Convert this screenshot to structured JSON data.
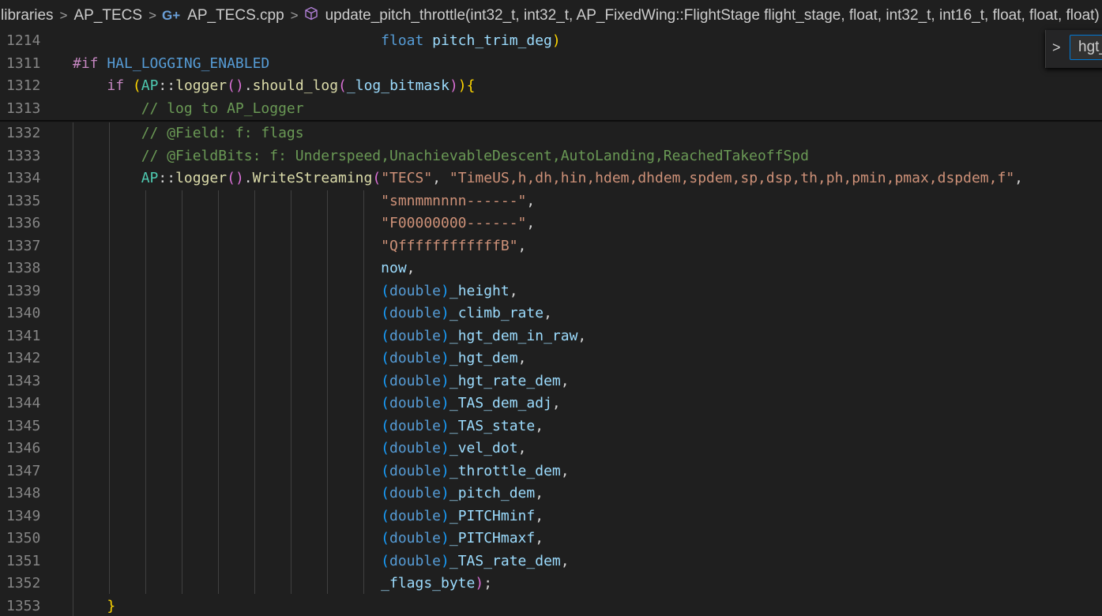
{
  "breadcrumb": {
    "items": [
      "libraries",
      "AP_TECS",
      "AP_TECS.cpp",
      "update_pitch_throttle(int32_t, int32_t, AP_FixedWing::FlightStage flight_stage, float, int32_t, int16_t, float, float, float)"
    ],
    "separator": ">",
    "file_icon": "c++-icon",
    "symbol_icon": "method-cube-icon"
  },
  "find_widget": {
    "toggle_icon": "chevron-right-icon",
    "value": "hgt_"
  },
  "sticky_lines": [
    {
      "num": "1214",
      "indent": 0,
      "tokens": [
        [
          "plain",
          "                                    "
        ],
        [
          "type",
          "float"
        ],
        [
          "plain",
          " "
        ],
        [
          "var",
          "pitch_trim_deg"
        ],
        [
          "p1",
          ")"
        ]
      ]
    },
    {
      "num": "1311",
      "indent": 0,
      "tokens": [
        [
          "pp",
          "#if"
        ],
        [
          "plain",
          " "
        ],
        [
          "macro",
          "HAL_LOGGING_ENABLED"
        ]
      ]
    },
    {
      "num": "1312",
      "indent": 0,
      "tokens": [
        [
          "plain",
          "    "
        ],
        [
          "kw",
          "if"
        ],
        [
          "plain",
          " "
        ],
        [
          "p1",
          "("
        ],
        [
          "ns",
          "AP"
        ],
        [
          "plain",
          "::"
        ],
        [
          "func",
          "logger"
        ],
        [
          "p2",
          "()"
        ],
        [
          "plain",
          "."
        ],
        [
          "func",
          "should_log"
        ],
        [
          "p2",
          "("
        ],
        [
          "var",
          "_log_bitmask"
        ],
        [
          "p2",
          ")"
        ],
        [
          "p1",
          ")"
        ],
        [
          "p1",
          "{"
        ]
      ]
    },
    {
      "num": "1313",
      "indent": 0,
      "tokens": [
        [
          "plain",
          "        "
        ],
        [
          "com",
          "// log to AP_Logger"
        ]
      ]
    }
  ],
  "lines": [
    {
      "num": "1332",
      "tokens": [
        [
          "plain",
          "        "
        ],
        [
          "com",
          "// @Field: f: flags"
        ]
      ]
    },
    {
      "num": "1333",
      "tokens": [
        [
          "plain",
          "        "
        ],
        [
          "com",
          "// @FieldBits: f: Underspeed,UnachievableDescent,AutoLanding,ReachedTakeoffSpd"
        ]
      ]
    },
    {
      "num": "1334",
      "tokens": [
        [
          "plain",
          "        "
        ],
        [
          "ns",
          "AP"
        ],
        [
          "plain",
          "::"
        ],
        [
          "func",
          "logger"
        ],
        [
          "p2",
          "()"
        ],
        [
          "plain",
          "."
        ],
        [
          "func",
          "WriteStreaming"
        ],
        [
          "p2",
          "("
        ],
        [
          "str",
          "\"TECS\""
        ],
        [
          "plain",
          ", "
        ],
        [
          "str",
          "\"TimeUS,h,dh,hin,hdem,dhdem,spdem,sp,dsp,th,ph,pmin,pmax,dspdem,f\""
        ],
        [
          "plain",
          ","
        ]
      ]
    },
    {
      "num": "1335",
      "tokens": [
        [
          "plain",
          "                                    "
        ],
        [
          "str",
          "\"smnmmnnnn------\""
        ],
        [
          "plain",
          ","
        ]
      ]
    },
    {
      "num": "1336",
      "tokens": [
        [
          "plain",
          "                                    "
        ],
        [
          "str",
          "\"F00000000------\""
        ],
        [
          "plain",
          ","
        ]
      ]
    },
    {
      "num": "1337",
      "tokens": [
        [
          "plain",
          "                                    "
        ],
        [
          "str",
          "\"QffffffffffffB\""
        ],
        [
          "plain",
          ","
        ]
      ]
    },
    {
      "num": "1338",
      "tokens": [
        [
          "plain",
          "                                    "
        ],
        [
          "var",
          "now"
        ],
        [
          "plain",
          ","
        ]
      ]
    },
    {
      "num": "1339",
      "tokens": [
        [
          "plain",
          "                                    "
        ],
        [
          "p3",
          "("
        ],
        [
          "type",
          "double"
        ],
        [
          "p3",
          ")"
        ],
        [
          "var",
          "_height"
        ],
        [
          "plain",
          ","
        ]
      ]
    },
    {
      "num": "1340",
      "tokens": [
        [
          "plain",
          "                                    "
        ],
        [
          "p3",
          "("
        ],
        [
          "type",
          "double"
        ],
        [
          "p3",
          ")"
        ],
        [
          "var",
          "_climb_rate"
        ],
        [
          "plain",
          ","
        ]
      ]
    },
    {
      "num": "1341",
      "tokens": [
        [
          "plain",
          "                                    "
        ],
        [
          "p3",
          "("
        ],
        [
          "type",
          "double"
        ],
        [
          "p3",
          ")"
        ],
        [
          "var",
          "_hgt_dem_in_raw"
        ],
        [
          "plain",
          ","
        ]
      ]
    },
    {
      "num": "1342",
      "tokens": [
        [
          "plain",
          "                                    "
        ],
        [
          "p3",
          "("
        ],
        [
          "type",
          "double"
        ],
        [
          "p3",
          ")"
        ],
        [
          "var",
          "_hgt_dem"
        ],
        [
          "plain",
          ","
        ]
      ]
    },
    {
      "num": "1343",
      "tokens": [
        [
          "plain",
          "                                    "
        ],
        [
          "p3",
          "("
        ],
        [
          "type",
          "double"
        ],
        [
          "p3",
          ")"
        ],
        [
          "var",
          "_hgt_rate_dem"
        ],
        [
          "plain",
          ","
        ]
      ]
    },
    {
      "num": "1344",
      "tokens": [
        [
          "plain",
          "                                    "
        ],
        [
          "p3",
          "("
        ],
        [
          "type",
          "double"
        ],
        [
          "p3",
          ")"
        ],
        [
          "var",
          "_TAS_dem_adj"
        ],
        [
          "plain",
          ","
        ]
      ]
    },
    {
      "num": "1345",
      "tokens": [
        [
          "plain",
          "                                    "
        ],
        [
          "p3",
          "("
        ],
        [
          "type",
          "double"
        ],
        [
          "p3",
          ")"
        ],
        [
          "var",
          "_TAS_state"
        ],
        [
          "plain",
          ","
        ]
      ]
    },
    {
      "num": "1346",
      "tokens": [
        [
          "plain",
          "                                    "
        ],
        [
          "p3",
          "("
        ],
        [
          "type",
          "double"
        ],
        [
          "p3",
          ")"
        ],
        [
          "var",
          "_vel_dot"
        ],
        [
          "plain",
          ","
        ]
      ]
    },
    {
      "num": "1347",
      "tokens": [
        [
          "plain",
          "                                    "
        ],
        [
          "p3",
          "("
        ],
        [
          "type",
          "double"
        ],
        [
          "p3",
          ")"
        ],
        [
          "var",
          "_throttle_dem"
        ],
        [
          "plain",
          ","
        ]
      ]
    },
    {
      "num": "1348",
      "tokens": [
        [
          "plain",
          "                                    "
        ],
        [
          "p3",
          "("
        ],
        [
          "type",
          "double"
        ],
        [
          "p3",
          ")"
        ],
        [
          "var",
          "_pitch_dem"
        ],
        [
          "plain",
          ","
        ]
      ]
    },
    {
      "num": "1349",
      "tokens": [
        [
          "plain",
          "                                    "
        ],
        [
          "p3",
          "("
        ],
        [
          "type",
          "double"
        ],
        [
          "p3",
          ")"
        ],
        [
          "var",
          "_PITCHminf"
        ],
        [
          "plain",
          ","
        ]
      ]
    },
    {
      "num": "1350",
      "tokens": [
        [
          "plain",
          "                                    "
        ],
        [
          "p3",
          "("
        ],
        [
          "type",
          "double"
        ],
        [
          "p3",
          ")"
        ],
        [
          "var",
          "_PITCHmaxf"
        ],
        [
          "plain",
          ","
        ]
      ]
    },
    {
      "num": "1351",
      "tokens": [
        [
          "plain",
          "                                    "
        ],
        [
          "p3",
          "("
        ],
        [
          "type",
          "double"
        ],
        [
          "p3",
          ")"
        ],
        [
          "var",
          "_TAS_rate_dem"
        ],
        [
          "plain",
          ","
        ]
      ]
    },
    {
      "num": "1352",
      "tokens": [
        [
          "plain",
          "                                    "
        ],
        [
          "var",
          "_flags_byte"
        ],
        [
          "p2",
          ")"
        ],
        [
          "plain",
          ";"
        ]
      ]
    },
    {
      "num": "1353",
      "tokens": [
        [
          "plain",
          "    "
        ],
        [
          "p1",
          "}"
        ]
      ]
    }
  ],
  "colors": {
    "background": "#1f1f1f",
    "line_number": "#858585",
    "keyword": "#c586c0",
    "type": "#569cd6",
    "function": "#dcdcaa",
    "namespace": "#4ec9b0",
    "variable": "#9cdcfe",
    "string": "#ce9178",
    "comment": "#6a9955",
    "bracket1": "#ffd700",
    "bracket2": "#da70d6",
    "bracket3": "#179fff"
  }
}
